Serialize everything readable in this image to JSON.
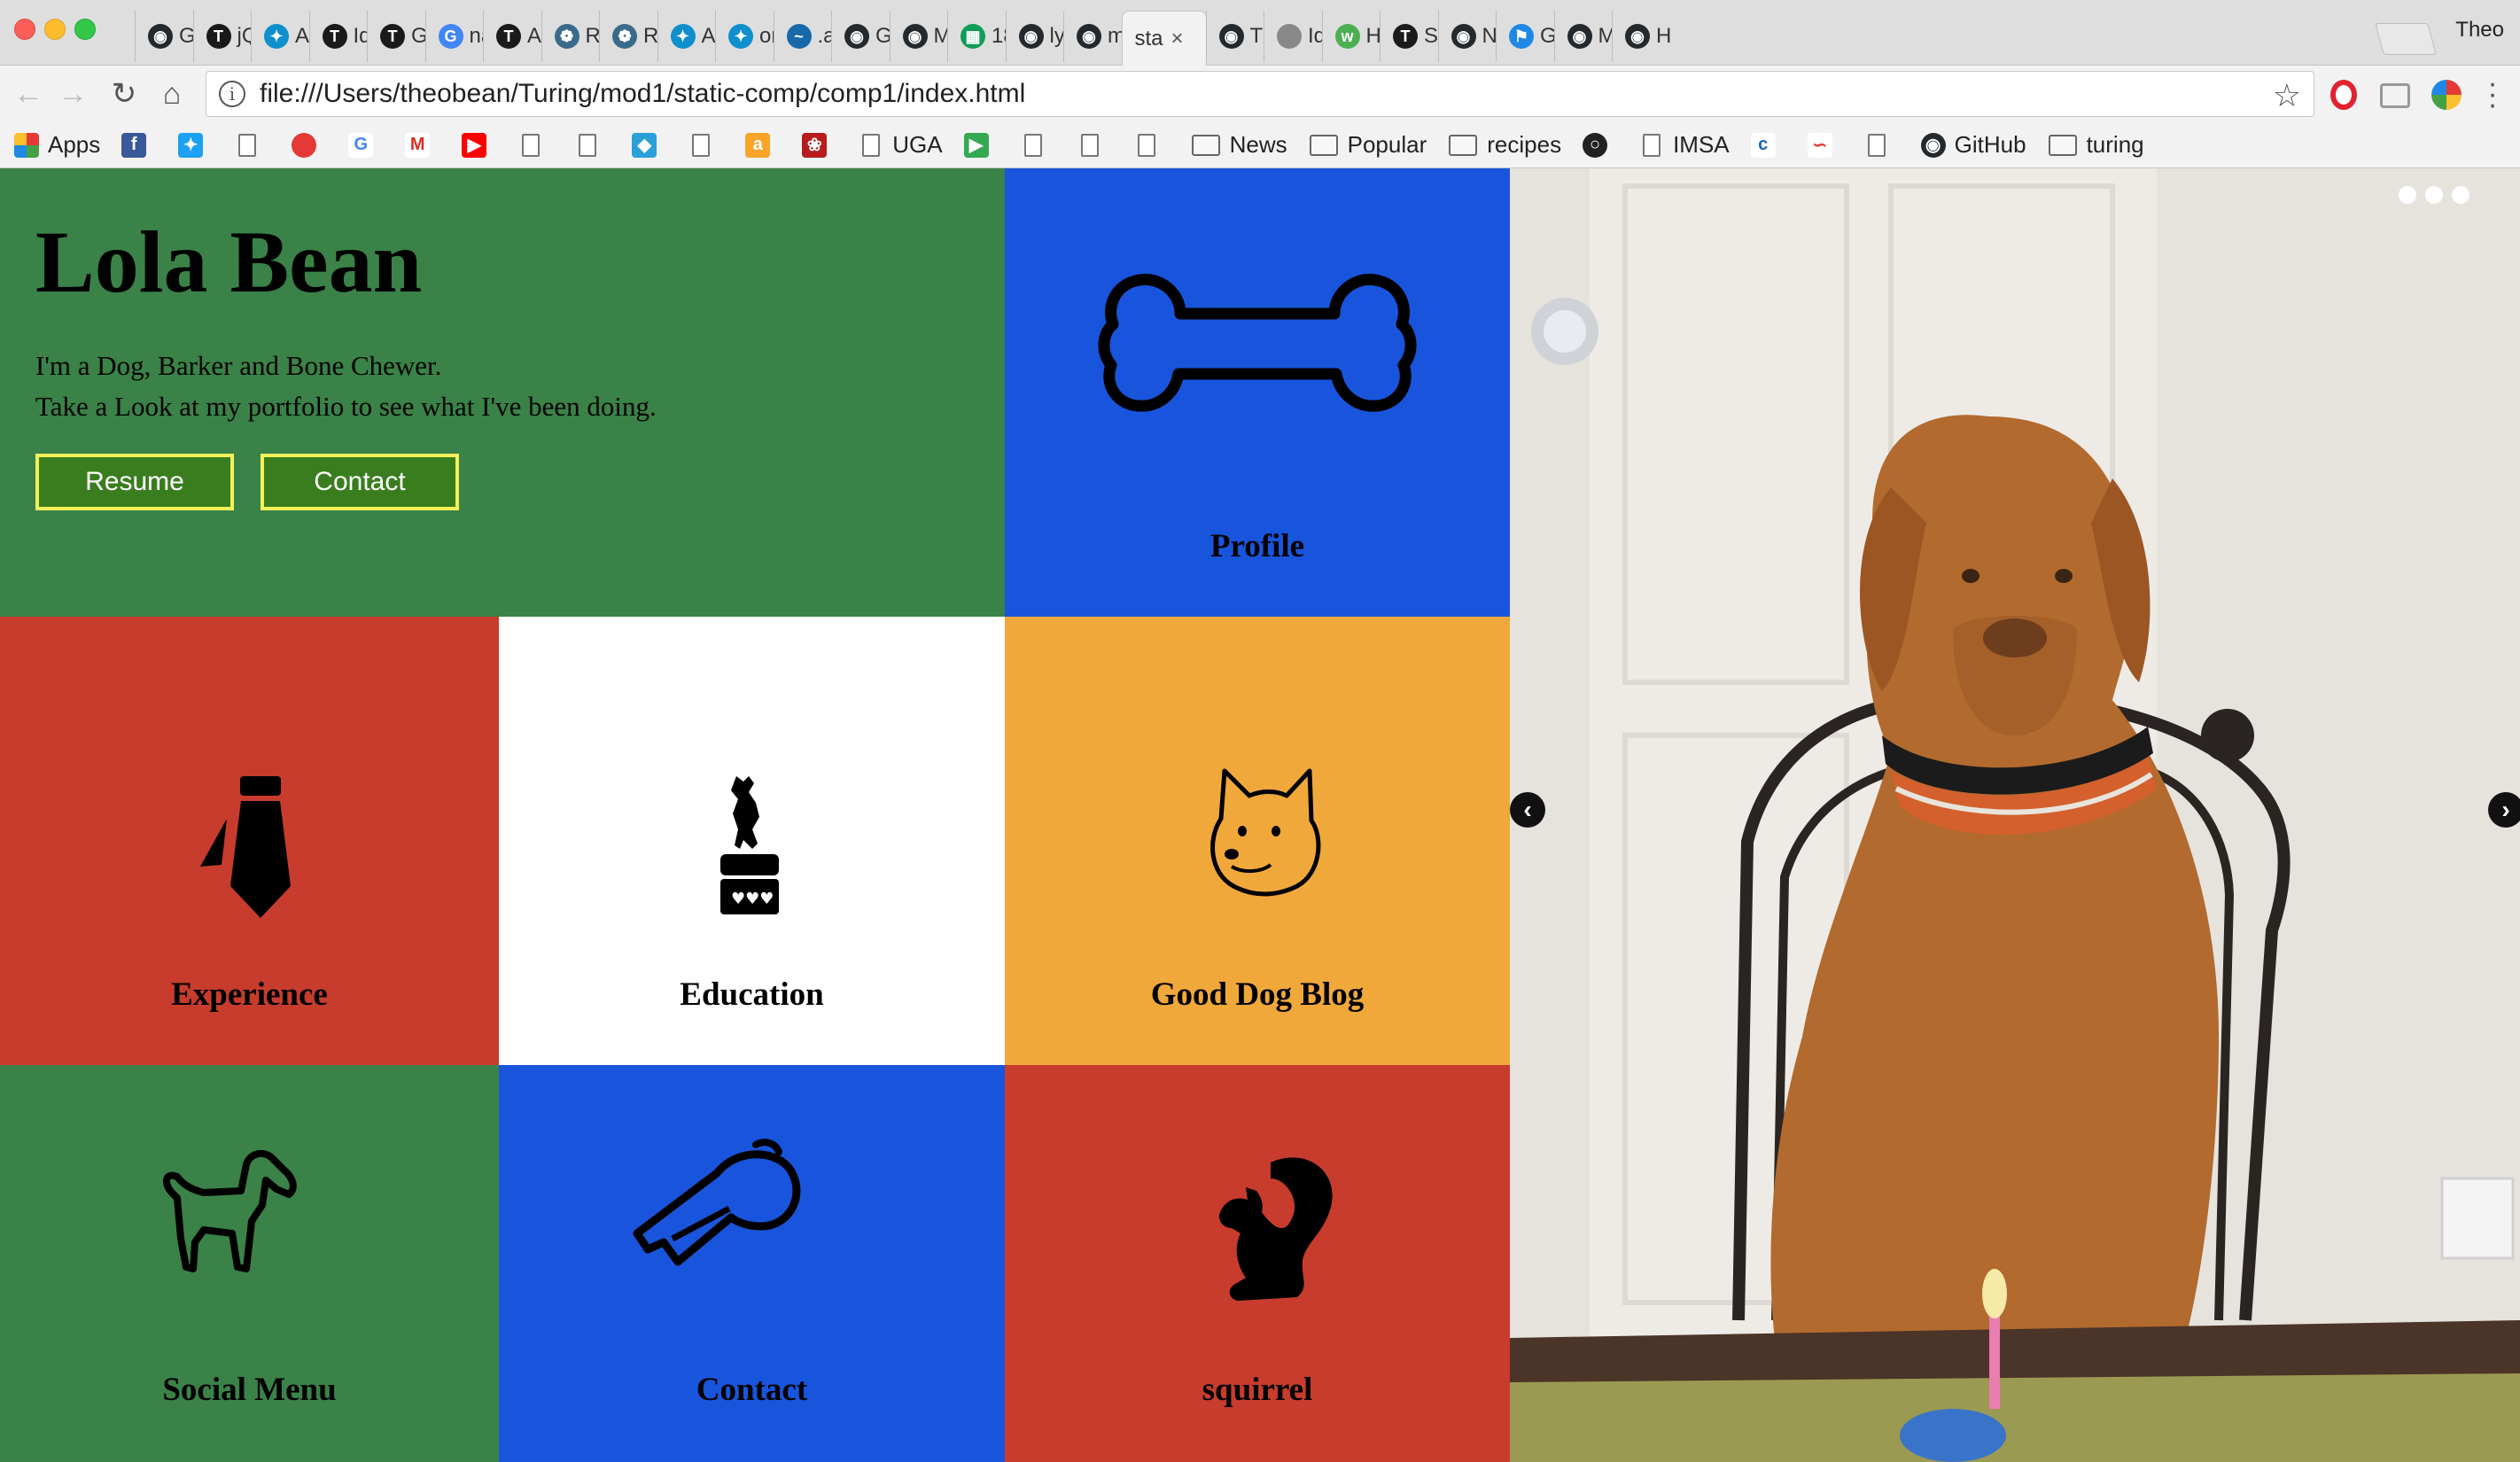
{
  "browser": {
    "tabs": [
      {
        "title": "Gi",
        "icon": "github-icon",
        "color": "#24292e"
      },
      {
        "title": "jQ",
        "icon": "turing-icon",
        "color": "#1a1a1a"
      },
      {
        "title": "Ar",
        "icon": "bird-icon",
        "color": "#0f8fcc"
      },
      {
        "title": "Id",
        "icon": "turing-icon",
        "color": "#1a1a1a"
      },
      {
        "title": "Gi",
        "icon": "turing-icon",
        "color": "#1a1a1a"
      },
      {
        "title": "na",
        "icon": "google-icon",
        "color": "#4285f4"
      },
      {
        "title": "Ar",
        "icon": "turing-icon",
        "color": "#1a1a1a"
      },
      {
        "title": "Re",
        "icon": "swirl-icon",
        "color": "#3a6b8a"
      },
      {
        "title": "Re",
        "icon": "swirl-icon",
        "color": "#3a6b8a"
      },
      {
        "title": "Ar",
        "icon": "bird-icon",
        "color": "#0f8fcc"
      },
      {
        "title": "or",
        "icon": "bird-icon",
        "color": "#0f8fcc"
      },
      {
        "title": ".a",
        "icon": "jquery-icon",
        "color": "#1769aa"
      },
      {
        "title": "Gi",
        "icon": "github-icon",
        "color": "#24292e"
      },
      {
        "title": "M",
        "icon": "github-icon",
        "color": "#24292e"
      },
      {
        "title": "18",
        "icon": "sheets-icon",
        "color": "#0f9d58"
      },
      {
        "title": "ly",
        "icon": "github-icon",
        "color": "#24292e"
      },
      {
        "title": "m",
        "icon": "github-icon",
        "color": "#24292e"
      },
      {
        "title": "sta",
        "icon": "none",
        "color": "#f2f2f2",
        "active": true
      },
      {
        "title": "Th",
        "icon": "github-icon",
        "color": "#24292e"
      },
      {
        "title": "Id",
        "icon": "doc-icon",
        "color": "#888888"
      },
      {
        "title": "H",
        "icon": "w3-icon",
        "color": "#4caf50"
      },
      {
        "title": "St",
        "icon": "turing-icon",
        "color": "#1a1a1a"
      },
      {
        "title": "Ne",
        "icon": "github-icon",
        "color": "#24292e"
      },
      {
        "title": "G",
        "icon": "flag-icon",
        "color": "#1e88e5"
      },
      {
        "title": "M",
        "icon": "github-icon",
        "color": "#24292e"
      },
      {
        "title": "He",
        "icon": "github-icon",
        "color": "#24292e"
      }
    ],
    "profile_name": "Theo",
    "url": "file:///Users/theobean/Turing/mod1/static-comp/comp1/index.html",
    "bookmarks": [
      {
        "label": "Apps",
        "icon": "apps-icon"
      },
      {
        "label": "",
        "icon": "facebook-icon"
      },
      {
        "label": "",
        "icon": "twitter-icon"
      },
      {
        "label": "",
        "icon": "doc-icon"
      },
      {
        "label": "",
        "icon": "tomato-icon"
      },
      {
        "label": "",
        "icon": "google-icon"
      },
      {
        "label": "",
        "icon": "gmail-icon"
      },
      {
        "label": "",
        "icon": "youtube-icon"
      },
      {
        "label": "",
        "icon": "doc-icon"
      },
      {
        "label": "",
        "icon": "doc-icon"
      },
      {
        "label": "",
        "icon": "diamond-icon"
      },
      {
        "label": "",
        "icon": "doc-icon"
      },
      {
        "label": "",
        "icon": "amazon-icon"
      },
      {
        "label": "",
        "icon": "seal-icon"
      },
      {
        "label": "UGA",
        "icon": "doc-icon"
      },
      {
        "label": "",
        "icon": "play-store-icon"
      },
      {
        "label": "",
        "icon": "doc-icon"
      },
      {
        "label": "",
        "icon": "doc-icon"
      },
      {
        "label": "",
        "icon": "doc-icon"
      },
      {
        "label": "News",
        "icon": "folder-icon"
      },
      {
        "label": "Popular",
        "icon": "folder-icon"
      },
      {
        "label": "recipes",
        "icon": "folder-icon"
      },
      {
        "label": "",
        "icon": "circle-icon"
      },
      {
        "label": "IMSA",
        "icon": "doc-icon"
      },
      {
        "label": "",
        "icon": "codeblock-icon"
      },
      {
        "label": "",
        "icon": "swoosh-icon"
      },
      {
        "label": "",
        "icon": "doc-icon"
      },
      {
        "label": "GitHub",
        "icon": "github-icon"
      },
      {
        "label": "turing",
        "icon": "folder-icon"
      }
    ]
  },
  "page": {
    "title": "Lola Bean",
    "intro_line_1": "I'm a Dog, Barker and Bone Chewer.",
    "intro_line_2": "Take a Look at my portfolio to see what I've been doing.",
    "resume_label": "Resume",
    "contact_button_label": "Contact",
    "tiles": {
      "profile": "Profile",
      "experience": "Experience",
      "education": "Education",
      "blog": "Good Dog Blog",
      "social": "Social Menu",
      "contact": "Contact",
      "squirrel": "squirrel"
    },
    "carousel": {
      "arrow_prev": "‹",
      "arrow_next": "›"
    }
  },
  "colors": {
    "green": "#3a8247",
    "blue": "#1955dc",
    "red": "#c73c2d",
    "orange": "#f0a83b",
    "button_fill": "#3a7d1e",
    "button_border": "#f3f05a"
  }
}
